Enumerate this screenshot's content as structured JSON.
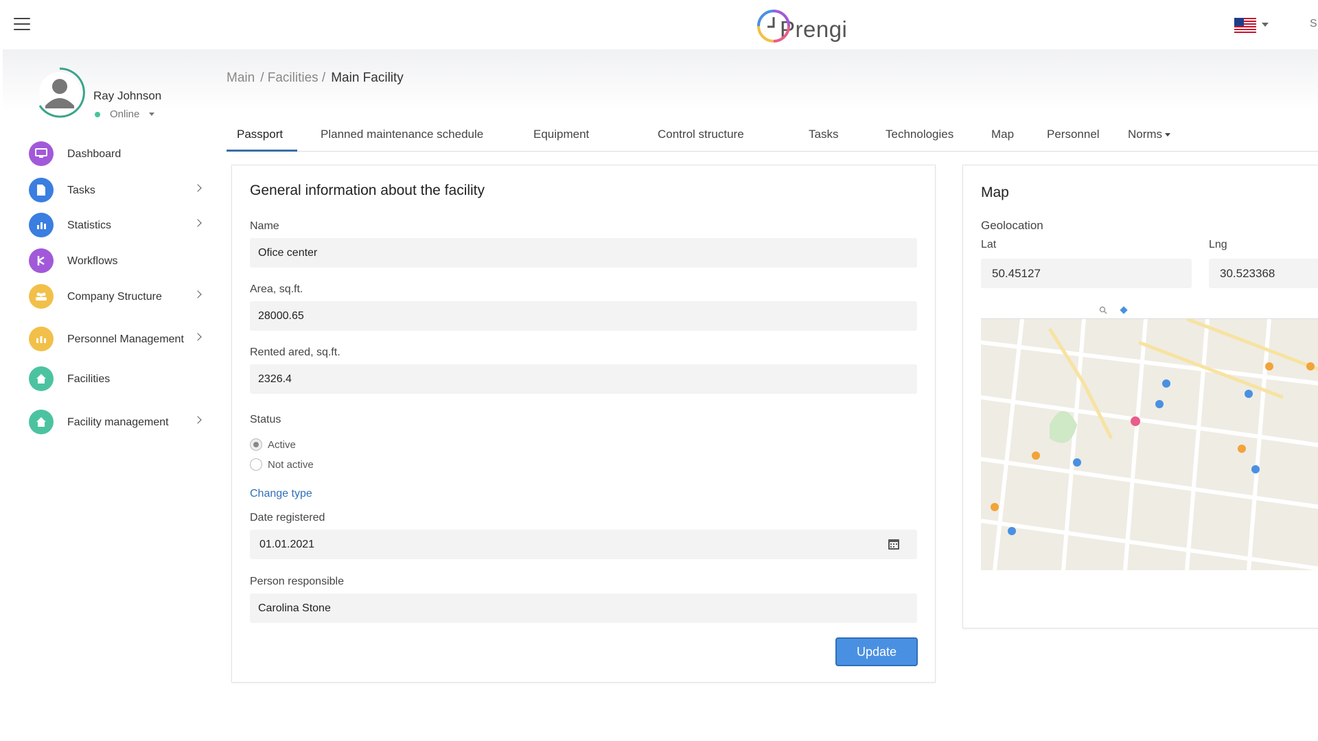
{
  "header": {
    "logo_text": "Prengi",
    "language_icon": "us-flag-icon",
    "edge_text": "S"
  },
  "user": {
    "name": "Ray Johnson",
    "status": "Online"
  },
  "sidebar": {
    "items": [
      {
        "label": "Dashboard",
        "icon": "monitor-icon",
        "color": "#a259d9",
        "has_submenu": false
      },
      {
        "label": "Tasks",
        "icon": "document-icon",
        "color": "#3a7ee0",
        "has_submenu": true
      },
      {
        "label": "Statistics",
        "icon": "bar-chart-icon",
        "color": "#3a7ee0",
        "has_submenu": true
      },
      {
        "label": "Workflows",
        "icon": "workflow-icon",
        "color": "#a259d9",
        "has_submenu": false
      },
      {
        "label": "Company Structure",
        "icon": "team-icon",
        "color": "#f2c049",
        "has_submenu": true
      },
      {
        "label": "Personnel Management",
        "icon": "personnel-icon",
        "color": "#f2c049",
        "has_submenu": true
      },
      {
        "label": "Facilities",
        "icon": "home-icon",
        "color": "#4cc3a0",
        "has_submenu": false
      },
      {
        "label": "Facility management",
        "icon": "home-icon",
        "color": "#4cc3a0",
        "has_submenu": true
      }
    ]
  },
  "breadcrumb": {
    "items": [
      "Main",
      "/ Facilities /",
      "Main Facility"
    ]
  },
  "tabs": [
    {
      "label": "Passport",
      "active": true
    },
    {
      "label": "Planned maintenance schedule"
    },
    {
      "label": "Equipment"
    },
    {
      "label": "Control structure"
    },
    {
      "label": "Tasks"
    },
    {
      "label": "Technologies"
    },
    {
      "label": "Map"
    },
    {
      "label": "Personnel"
    },
    {
      "label": "Norms"
    }
  ],
  "general": {
    "title": "General information about the facility",
    "name_label": "Name",
    "name_value": "Ofice center",
    "area_label": "Area, sq.ft.",
    "area_value": "28000.65",
    "rented_label": "Rented ared, sq.ft.",
    "rented_value": "2326.4",
    "status_label": "Status",
    "status_options": [
      "Active",
      "Not active"
    ],
    "status_selected": "Active",
    "change_type_link": "Change type",
    "date_label": "Date registered",
    "date_value": "01.01.2021",
    "person_label": "Person responsible",
    "person_value": "Carolina Stone",
    "update_button": "Update"
  },
  "map_card": {
    "title": "Map",
    "geolocation_label": "Geolocation",
    "lat_label": "Lat",
    "lat_value": "50.45127",
    "lng_label": "Lng",
    "lng_value": "30.523368"
  },
  "colors": {
    "accent": "#2f6fb8",
    "button": "#4a90e2",
    "online": "#43c59e"
  }
}
